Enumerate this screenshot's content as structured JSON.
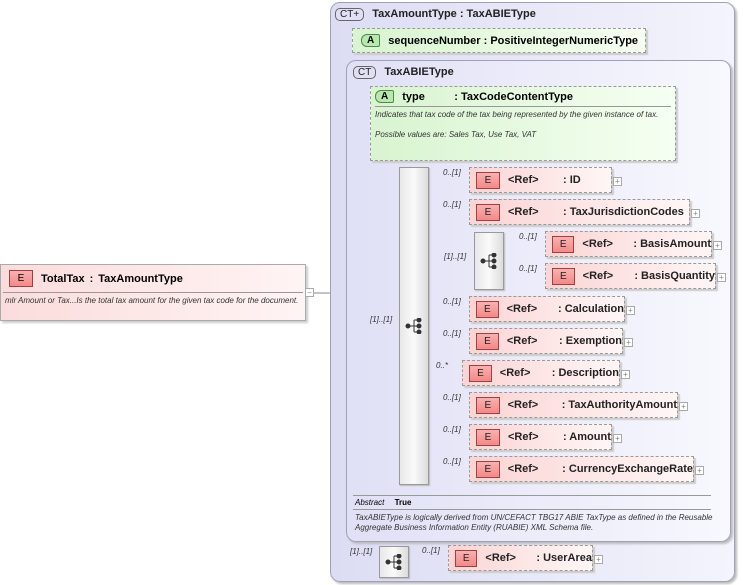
{
  "root": {
    "badge": "E",
    "name": "TotalTax",
    "type": "TaxAmountType",
    "doc": "mlr   Amount or Tax...Is the total tax amount for the given tax code for the document.",
    "toggle": "−"
  },
  "outer": {
    "badge": "CT+",
    "title": "TaxAmountType : TaxABIEType"
  },
  "seq_attr": {
    "badge": "A",
    "label": "sequenceNumber : PositiveIntegerNumericType"
  },
  "inner": {
    "badge": "CT",
    "title": "TaxABIEType",
    "abstract_label": "Abstract",
    "abstract_value": "True",
    "doc": "TaxABIEType is logically derived from UN/CEFACT TBG17 ABIE TaxType as defined in the Reusable Aggregate Business Information Entity (RUABIE) XML Schema file."
  },
  "type_attr": {
    "badge": "A",
    "name": "type",
    "type": ": TaxCodeContentType",
    "doc1": "Indicates that tax code of the tax being represented by the given instance of tax.",
    "doc2": "Possible values are: Sales Tax, Use Tax, VAT"
  },
  "sequence_card": "[1]..[1]",
  "choice_card": "[1]..[1]",
  "elements": [
    {
      "card": "0..[1]",
      "ref": "<Ref>",
      "name": ": ID"
    },
    {
      "card": "0..[1]",
      "ref": "<Ref>",
      "name": ": TaxJurisdictionCodes"
    },
    {
      "card": "0..[1]",
      "ref": "<Ref>",
      "name": ": BasisAmount"
    },
    {
      "card": "0..[1]",
      "ref": "<Ref>",
      "name": ": BasisQuantity"
    },
    {
      "card": "0..[1]",
      "ref": "<Ref>",
      "name": ": Calculation"
    },
    {
      "card": "0..[1]",
      "ref": "<Ref>",
      "name": ": Exemption"
    },
    {
      "card": "0..*",
      "ref": "<Ref>",
      "name": ": Description"
    },
    {
      "card": "0..[1]",
      "ref": "<Ref>",
      "name": ": TaxAuthorityAmount"
    },
    {
      "card": "0..[1]",
      "ref": "<Ref>",
      "name": ": Amount"
    },
    {
      "card": "0..[1]",
      "ref": "<Ref>",
      "name": ": CurrencyExchangeRate"
    }
  ],
  "outer_seq_card": "[1]..[1]",
  "userarea": {
    "card": "0..[1]",
    "ref": "<Ref>",
    "name": ": UserArea"
  },
  "element_badge": "E",
  "plus": "+"
}
